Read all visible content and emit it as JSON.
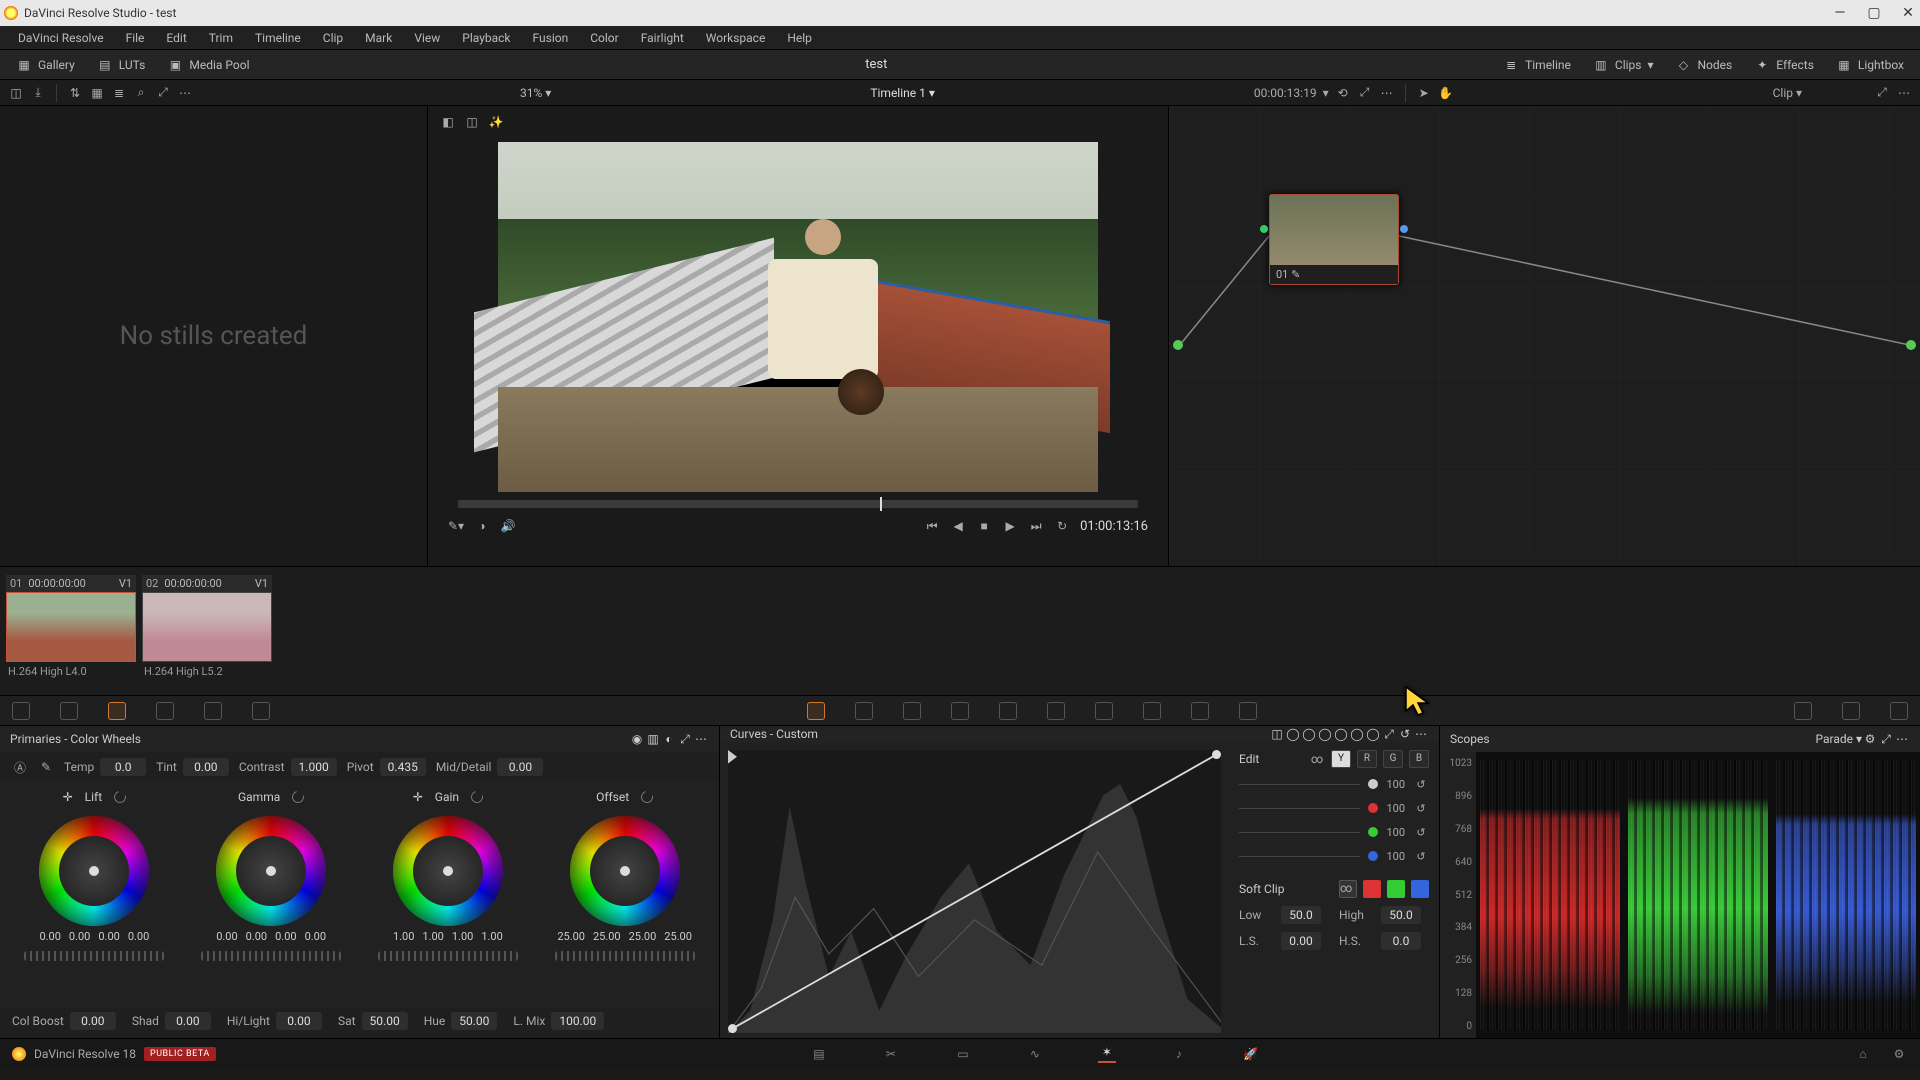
{
  "titlebar": {
    "text": "DaVinci Resolve Studio - test"
  },
  "menubar": [
    "DaVinci Resolve",
    "File",
    "Edit",
    "Trim",
    "Timeline",
    "Clip",
    "Mark",
    "View",
    "Playback",
    "Fusion",
    "Color",
    "Fairlight",
    "Workspace",
    "Help"
  ],
  "toolbar": {
    "gallery": "Gallery",
    "luts": "LUTs",
    "mediapool": "Media Pool",
    "project_name": "test",
    "timeline_btn": "Timeline",
    "clips_btn": "Clips",
    "nodes_btn": "Nodes",
    "effects_btn": "Effects",
    "lightbox_btn": "Lightbox"
  },
  "viewer_bar": {
    "zoom": "31%",
    "timeline_name": "Timeline 1",
    "record_tc": "00:00:13:19",
    "clip_label": "Clip"
  },
  "gallery": {
    "empty_text": "No stills created"
  },
  "playback": {
    "source_tc": "01:00:13:16"
  },
  "node": {
    "label": "01",
    "node_icon_hint": "✎"
  },
  "clips": [
    {
      "idx": "01",
      "tc": "00:00:00:00",
      "track": "V1",
      "codec": "H.264 High L4.0"
    },
    {
      "idx": "02",
      "tc": "00:00:00:00",
      "track": "V1",
      "codec": "H.264 High L5.2"
    }
  ],
  "primaries": {
    "title": "Primaries - Color Wheels",
    "temp_label": "Temp",
    "temp_val": "0.0",
    "tint_label": "Tint",
    "tint_val": "0.00",
    "contrast_label": "Contrast",
    "contrast_val": "1.000",
    "pivot_label": "Pivot",
    "pivot_val": "0.435",
    "md_label": "Mid/Detail",
    "md_val": "0.00",
    "wheels": {
      "lift": {
        "name": "Lift",
        "vals": [
          "0.00",
          "0.00",
          "0.00",
          "0.00"
        ]
      },
      "gamma": {
        "name": "Gamma",
        "vals": [
          "0.00",
          "0.00",
          "0.00",
          "0.00"
        ]
      },
      "gain": {
        "name": "Gain",
        "vals": [
          "1.00",
          "1.00",
          "1.00",
          "1.00"
        ]
      },
      "offset": {
        "name": "Offset",
        "vals": [
          "25.00",
          "25.00",
          "25.00",
          "25.00"
        ]
      }
    },
    "bottom": {
      "colboost_label": "Col Boost",
      "colboost_val": "0.00",
      "shad_label": "Shad",
      "shad_val": "0.00",
      "hilight_label": "Hi/Light",
      "hilight_val": "0.00",
      "sat_label": "Sat",
      "sat_val": "50.00",
      "hue_label": "Hue",
      "hue_val": "50.00",
      "lmix_label": "L. Mix",
      "lmix_val": "100.00"
    }
  },
  "curves": {
    "title": "Curves - Custom",
    "edit_label": "Edit",
    "channel_btns": {
      "y": "Y",
      "r": "R",
      "g": "G",
      "b": "B"
    },
    "chan_vals": {
      "w": "100",
      "r": "100",
      "g": "100",
      "b": "100"
    },
    "softclip_label": "Soft Clip",
    "low_label": "Low",
    "low_val": "50.0",
    "high_label": "High",
    "high_val": "50.0",
    "ls_label": "L.S.",
    "ls_val": "0.00",
    "hs_label": "H.S.",
    "hs_val": "0.0"
  },
  "scopes": {
    "title": "Scopes",
    "mode": "Parade",
    "ticks": [
      "1023",
      "896",
      "768",
      "640",
      "512",
      "384",
      "256",
      "128",
      "0"
    ]
  },
  "pager": {
    "version_text": "DaVinci Resolve 18",
    "badge": "PUBLIC BETA"
  }
}
